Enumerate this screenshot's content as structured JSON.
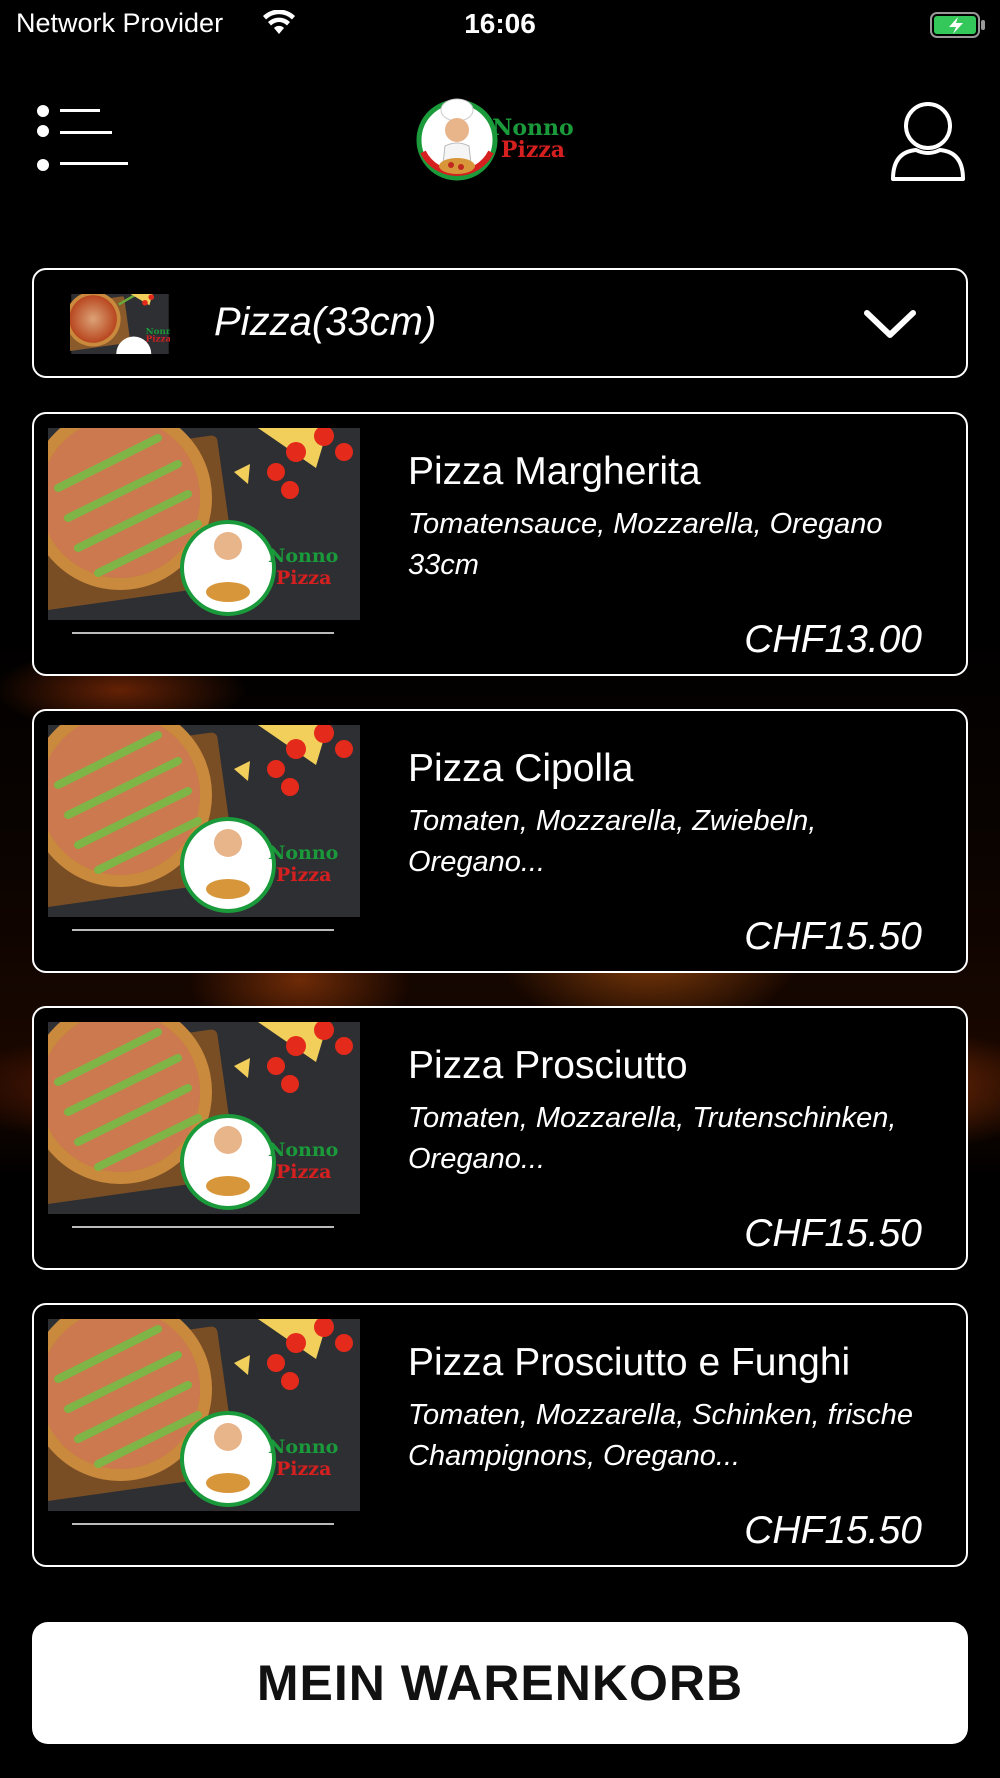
{
  "status_bar": {
    "carrier": "Network Provider",
    "time": "16:06",
    "battery_color": "#34c759"
  },
  "header": {
    "menu_icon": "hamburger-menu-icon",
    "logo_text_line1": "Nonno",
    "logo_text_line2": "Pizza",
    "user_icon": "user-profile-icon"
  },
  "category": {
    "label": "Pizza(33cm)",
    "icon": "chevron-down-icon"
  },
  "products": [
    {
      "name": "Pizza Margherita",
      "description": "Tomatensauce, Mozzarella, Oregano 33cm",
      "price": "CHF13.00"
    },
    {
      "name": "Pizza Cipolla",
      "description": "Tomaten, Mozzarella, Zwiebeln, Oregano...",
      "price": "CHF15.50"
    },
    {
      "name": "Pizza Prosciutto",
      "description": "Tomaten, Mozzarella, Trutenschinken, Oregano...",
      "price": "CHF15.50"
    },
    {
      "name": "Pizza Prosciutto e Funghi",
      "description": "Tomaten, Mozzarella, Schinken, frische Champignons, Oregano...",
      "price": "CHF15.50"
    }
  ],
  "cart": {
    "label": "MEIN WARENKORB"
  },
  "colors": {
    "logo_green": "#1a9a3a",
    "logo_red": "#d62020",
    "background": "#000000"
  }
}
